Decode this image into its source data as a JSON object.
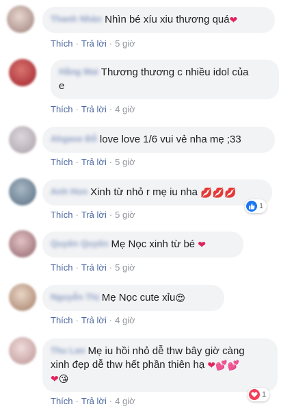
{
  "actions": {
    "like": "Thích",
    "reply": "Trả lời",
    "separator": "·"
  },
  "colors": {
    "bubble": "#f2f3f5",
    "link": "#4b67a1",
    "like_blue": "#1877f2",
    "love_red": "#f33e58"
  },
  "comments": [
    {
      "name": "Thanh Nhàn",
      "text": "Nhìn bé xíu xiu thương quá",
      "emojis": [
        "heart"
      ],
      "time": "5 giờ"
    },
    {
      "name": "Hằng Mai",
      "text": "Thương thương c nhiều idol của\ne",
      "emojis": [],
      "time": "4 giờ"
    },
    {
      "name": "Ahgase Đỗ",
      "text": "love love 1/6 vui vẻ nha mẹ ;33",
      "emojis": [],
      "time": "5 giờ"
    },
    {
      "name": "Anh Hon",
      "text": "Xinh từ nhỏ r mẹ iu nha ",
      "emojis": [
        "kiss-lips",
        "kiss-lips",
        "kiss-lips"
      ],
      "time": "5 giờ",
      "reaction": {
        "icon": "like-icon",
        "count": "1"
      }
    },
    {
      "name": "Quyên Quyên",
      "text": "Mẹ Nọc xinh từ bé ",
      "emojis": [
        "heart"
      ],
      "time": "5 giờ"
    },
    {
      "name": "Nguyễn Thị",
      "text": "Mẹ Nọc cute xỉu",
      "emojis": [
        "heart-eyes-face"
      ],
      "time": "4 giờ"
    },
    {
      "name": "Thu Lan",
      "text": "Mẹ iu hồi nhỏ dễ thw bây giờ càng\nxinh đẹp dễ thw hết phần thiên hạ ",
      "emojis": [
        "heart",
        "two-hearts",
        "two-hearts",
        "heart",
        "kissing-face"
      ],
      "time": "4 giờ",
      "reaction": {
        "icon": "love-icon",
        "count": "1"
      }
    }
  ]
}
